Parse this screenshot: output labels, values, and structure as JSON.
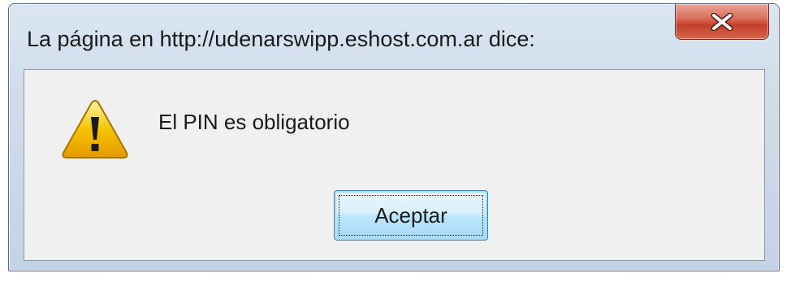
{
  "dialog": {
    "title": "La página en http://udenarswipp.eshost.com.ar dice:",
    "message": "El PIN es obligatorio",
    "ok_button_label": "Aceptar",
    "close_icon": "close-icon",
    "message_icon": "warning-icon"
  },
  "colors": {
    "close_button": "#c3402a",
    "ok_button_border": "#3c7fb1",
    "client_background": "#f0f0f0",
    "warning_yellow": "#f5c400"
  }
}
